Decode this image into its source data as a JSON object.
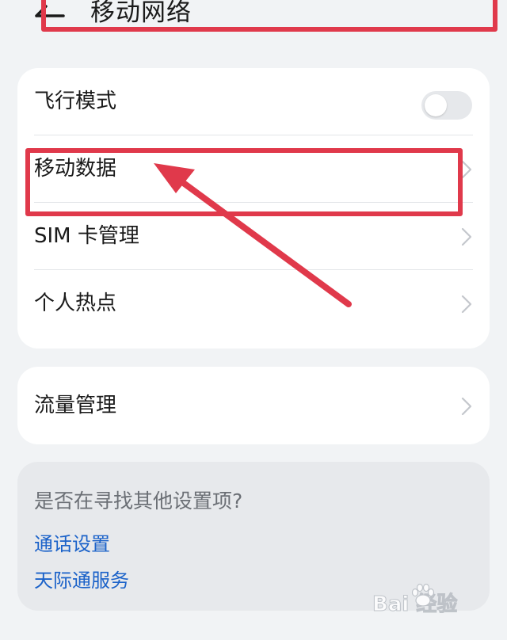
{
  "header": {
    "title": "移动网络",
    "back_icon": "back-arrow-icon"
  },
  "network_card": {
    "items": [
      {
        "label": "飞行模式",
        "control": "toggle",
        "toggle_on": false
      },
      {
        "label": "移动数据",
        "control": "chevron"
      },
      {
        "label": "SIM 卡管理",
        "control": "chevron"
      },
      {
        "label": "个人热点",
        "control": "chevron"
      }
    ]
  },
  "traffic_card": {
    "items": [
      {
        "label": "流量管理",
        "control": "chevron"
      }
    ]
  },
  "search_card": {
    "prompt": "是否在寻找其他设置项?",
    "links": [
      {
        "label": "通话设置"
      },
      {
        "label": "天际通服务"
      }
    ]
  },
  "watermark": {
    "text": "Bai 经验"
  },
  "colors": {
    "background": "#f1f3f5",
    "card": "#ffffff",
    "search_card": "#e7e9ec",
    "link": "#1b62c9",
    "annotation": "#e0394b",
    "toggle_off": "#e6e8eb"
  }
}
